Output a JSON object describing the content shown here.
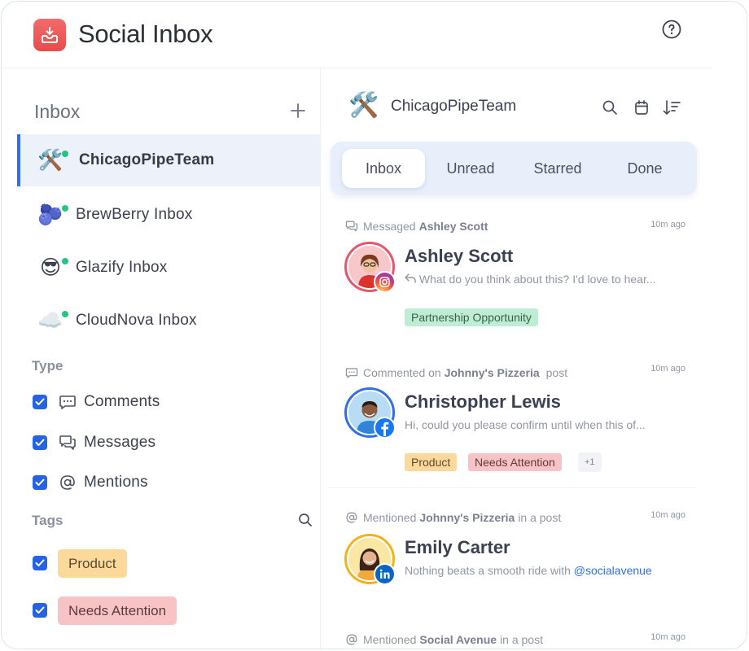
{
  "app": {
    "title": "Social Inbox"
  },
  "sidebar": {
    "inbox_heading": "Inbox",
    "inboxes": [
      {
        "name": "ChicagoPipeTeam",
        "emoji": "🛠️",
        "active": true,
        "online": true
      },
      {
        "name": "BrewBerry Inbox",
        "emoji": "🫐",
        "active": false,
        "online": true
      },
      {
        "name": "Glazify Inbox",
        "emoji": "😎",
        "active": false,
        "online": true
      },
      {
        "name": "CloudNova Inbox",
        "emoji": "☁️",
        "active": false,
        "online": true
      }
    ],
    "type_title": "Type",
    "types": [
      {
        "label": "Comments",
        "icon": "comment-icon",
        "checked": true
      },
      {
        "label": "Messages",
        "icon": "messages-icon",
        "checked": true
      },
      {
        "label": "Mentions",
        "icon": "at-icon",
        "checked": true
      }
    ],
    "tags_title": "Tags",
    "tags": [
      {
        "label": "Product",
        "checked": true,
        "color": "#fcd99a"
      },
      {
        "label": "Needs Attention",
        "checked": true,
        "color": "#f8c3c5"
      }
    ]
  },
  "main": {
    "team_name": "ChicagoPipeTeam",
    "team_emoji": "🛠️",
    "tabs": [
      "Inbox",
      "Unread",
      "Starred",
      "Done"
    ],
    "active_tab": "Inbox",
    "conversations": [
      {
        "meta_prefix": "Messaged",
        "meta_subject": "Ashley Scott",
        "meta_suffix": "",
        "time": "10m ago",
        "name": "Ashley Scott",
        "preview": "What do you think about this? I'd love to hear...",
        "network": "instagram",
        "tags": [
          "Partnership Opportunity"
        ]
      },
      {
        "meta_prefix": "Commented on",
        "meta_subject": "Johnny's Pizzeria",
        "meta_suffix": "post",
        "time": "10m ago",
        "name": "Christopher Lewis",
        "preview": "Hi, could you please confirm until when this of...",
        "network": "facebook",
        "tags": [
          "Product",
          "Needs Attention"
        ],
        "more_tags": "+1"
      },
      {
        "meta_prefix": "Mentioned",
        "meta_subject": "Johnny's Pizzeria",
        "meta_suffix": "in a post",
        "time": "10m ago",
        "name": "Emily Carter",
        "preview": "Nothing beats a smooth ride with",
        "preview_mention": "@socialavenue",
        "network": "linkedin"
      },
      {
        "meta_prefix": "Mentioned",
        "meta_subject": "Social Avenue",
        "meta_suffix": "in a post",
        "time": "10m ago"
      }
    ]
  },
  "colors": {
    "accent": "#2f6fe8",
    "online": "#28c283",
    "tab_bar": "#e8effa",
    "active_inbox_bg": "#edf2fa"
  }
}
